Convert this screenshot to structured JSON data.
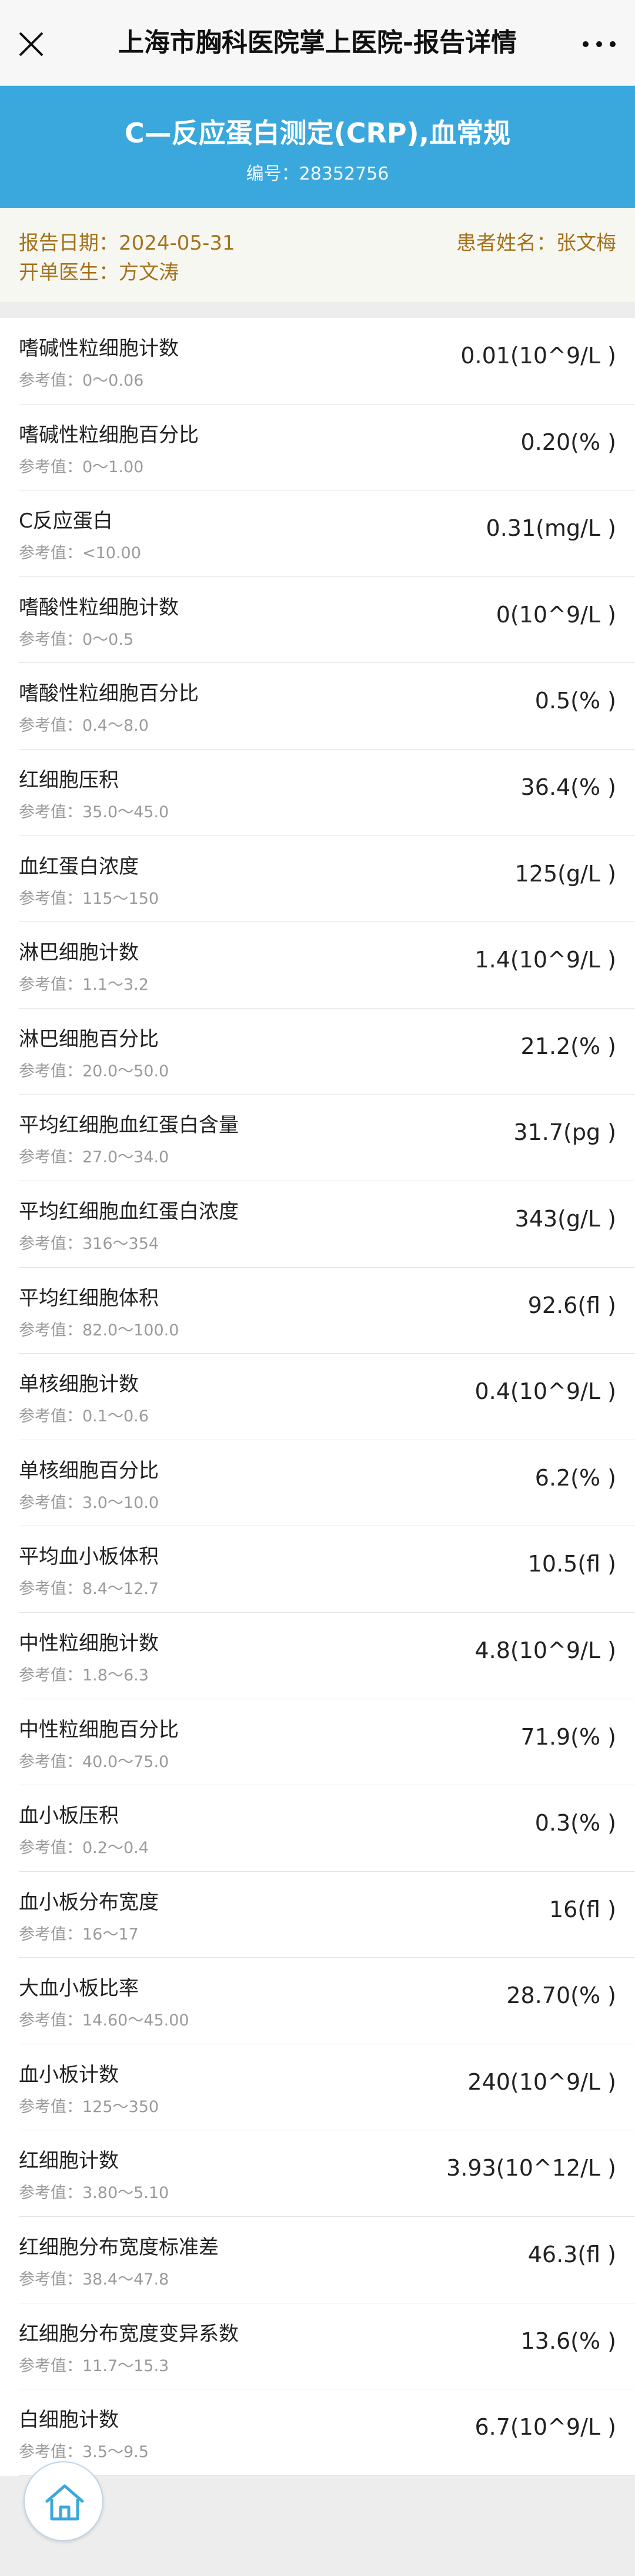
{
  "nav": {
    "title": "上海市胸科医院掌上医院-报告详情",
    "close_icon": "close-icon",
    "more_icon": "more-icon"
  },
  "report": {
    "title": "C—反应蛋白测定(CRP),血常规",
    "number": "编号：28352756"
  },
  "info": {
    "date": "报告日期：2024-05-31",
    "patient": "患者姓名：张文梅",
    "doctor": "开单医生：方文涛"
  },
  "items": [
    {
      "name": "嗜碱性粒细胞计数",
      "ref": "参考值：0～0.06",
      "value": "0.01(10^9/L )"
    },
    {
      "name": "嗜碱性粒细胞百分比",
      "ref": "参考值：0～1.00",
      "value": "0.20(% )"
    },
    {
      "name": "C反应蛋白",
      "ref": "参考值：<10.00",
      "value": "0.31(mg/L )"
    },
    {
      "name": "嗜酸性粒细胞计数",
      "ref": "参考值：0～0.5",
      "value": "0(10^9/L )"
    },
    {
      "name": "嗜酸性粒细胞百分比",
      "ref": "参考值：0.4～8.0",
      "value": "0.5(% )"
    },
    {
      "name": "红细胞压积",
      "ref": "参考值：35.0～45.0",
      "value": "36.4(% )"
    },
    {
      "name": "血红蛋白浓度",
      "ref": "参考值：115～150",
      "value": "125(g/L )"
    },
    {
      "name": "淋巴细胞计数",
      "ref": "参考值：1.1～3.2",
      "value": "1.4(10^9/L )"
    },
    {
      "name": "淋巴细胞百分比",
      "ref": "参考值：20.0～50.0",
      "value": "21.2(% )"
    },
    {
      "name": "平均红细胞血红蛋白含量",
      "ref": "参考值：27.0～34.0",
      "value": "31.7(pg )"
    },
    {
      "name": "平均红细胞血红蛋白浓度",
      "ref": "参考值：316～354",
      "value": "343(g/L )"
    },
    {
      "name": "平均红细胞体积",
      "ref": "参考值：82.0～100.0",
      "value": "92.6(fl )"
    },
    {
      "name": "单核细胞计数",
      "ref": "参考值：0.1～0.6",
      "value": "0.4(10^9/L )"
    },
    {
      "name": "单核细胞百分比",
      "ref": "参考值：3.0～10.0",
      "value": "6.2(% )"
    },
    {
      "name": "平均血小板体积",
      "ref": "参考值：8.4～12.7",
      "value": "10.5(fl )"
    },
    {
      "name": "中性粒细胞计数",
      "ref": "参考值：1.8～6.3",
      "value": "4.8(10^9/L )"
    },
    {
      "name": "中性粒细胞百分比",
      "ref": "参考值：40.0～75.0",
      "value": "71.9(% )"
    },
    {
      "name": "血小板压积",
      "ref": "参考值：0.2～0.4",
      "value": "0.3(% )"
    },
    {
      "name": "血小板分布宽度",
      "ref": "参考值：16～17",
      "value": "16(fl )"
    },
    {
      "name": "大血小板比率",
      "ref": "参考值：14.60～45.00",
      "value": "28.70(% )"
    },
    {
      "name": "血小板计数",
      "ref": "参考值：125～350",
      "value": "240(10^9/L )"
    },
    {
      "name": "红细胞计数",
      "ref": "参考值：3.80～5.10",
      "value": "3.93(10^12/L )"
    },
    {
      "name": "红细胞分布宽度标准差",
      "ref": "参考值：38.4～47.8",
      "value": "46.3(fl )"
    },
    {
      "name": "红细胞分布宽度变异系数",
      "ref": "参考值：11.7～15.3",
      "value": "13.6(% )"
    },
    {
      "name": "白细胞计数",
      "ref": "参考值：3.5～9.5",
      "value": "6.7(10^9/L )"
    }
  ],
  "home_icon": "home-icon",
  "colors": {
    "banner": "#3aa8dc",
    "info_text": "#a5721c"
  }
}
